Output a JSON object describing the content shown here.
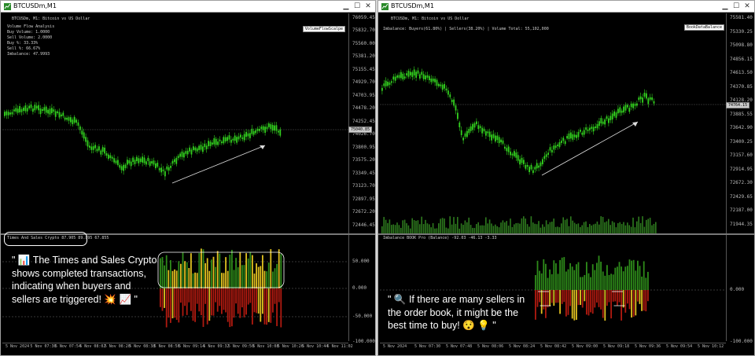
{
  "left": {
    "title": "BTCUSDm,M1",
    "symbol_line": "BTCUSDm, M1:  Bitcoin vs US Dollar",
    "info_lines": [
      "Volume Flow Analysis",
      "Buy Volume: 1.0000",
      "Sell Volume: 2.0000",
      "Buy %: 33.33%",
      "Sell %: 66.67%",
      "Imbalance: 47.9993"
    ],
    "indicator_tag": "VolumeFlowScalpe",
    "price_labels": [
      "76059.45",
      "75832.70",
      "75560.00",
      "75381.20",
      "75155.45",
      "74929.70",
      "74703.95",
      "74478.20",
      "74252.45",
      "74026.70",
      "73800.95",
      "73575.20",
      "73349.45",
      "73123.70",
      "72897.95",
      "72672.20",
      "72446.45"
    ],
    "current_price": "75040.85",
    "sub_label": "Times And Sales Crypto  87.905  89.895  67.855",
    "sub_scale": [
      "50.000",
      "0.000",
      "-50.000",
      "-100.000"
    ],
    "time_labels": [
      "5 Nov 2024",
      "5 Nov 07:36",
      "5 Nov 07:54",
      "5 Nov 08:02",
      "5 Nov 08:20",
      "5 Nov 08:38",
      "5 Nov 08:56",
      "5 Nov 09:14",
      "5 Nov 09:32",
      "5 Nov 09:50",
      "5 Nov 10:08",
      "5 Nov 10:26",
      "5 Nov 10:44",
      "5 Nov 11:02"
    ],
    "annotation": "\" 📊 The Times and Sales Crypto shows completed transactions, indicating when buyers and sellers are triggered! 💥 📈 \""
  },
  "right": {
    "title": "BTCUSDm,M1",
    "symbol_line": "BTCUSDm, M1:  Bitcoin vs US Dollar",
    "info_line": "Imbalance: Buyers(61.80%)  |  Sellers(38.20%)  |  Volume Total: 55,102,000",
    "indicator_tag": "BookDataBalance",
    "price_labels": [
      "75581.40",
      "75330.25",
      "75098.80",
      "74856.15",
      "74613.50",
      "74370.85",
      "74128.20",
      "73885.55",
      "73642.90",
      "73400.25",
      "73157.60",
      "72914.95",
      "72672.30",
      "72429.65",
      "72187.00",
      "71944.35"
    ],
    "current_price": "74764.15",
    "sub_label": "Imbalance BOOK Pro (Balance)  -92.03  -46.13  -3.33",
    "sub_scale": [
      "0.000",
      "-100.000"
    ],
    "time_labels": [
      "5 Nov 2024",
      "5 Nov 07:30",
      "5 Nov 07:48",
      "5 Nov 08:06",
      "5 Nov 08:24",
      "5 Nov 08:42",
      "5 Nov 09:00",
      "5 Nov 09:18",
      "5 Nov 09:36",
      "5 Nov 09:54",
      "5 Nov 10:12"
    ],
    "annotation": "\" 🔍 If there are many sellers in the order book, it might be the best time to buy! 😯 💡 \""
  },
  "colors": {
    "bull": "#32d11e",
    "buy_bar": "#2e8b1a",
    "sell_bar": "#b01a10",
    "trigger": "#e0c020",
    "background": "#000000"
  }
}
